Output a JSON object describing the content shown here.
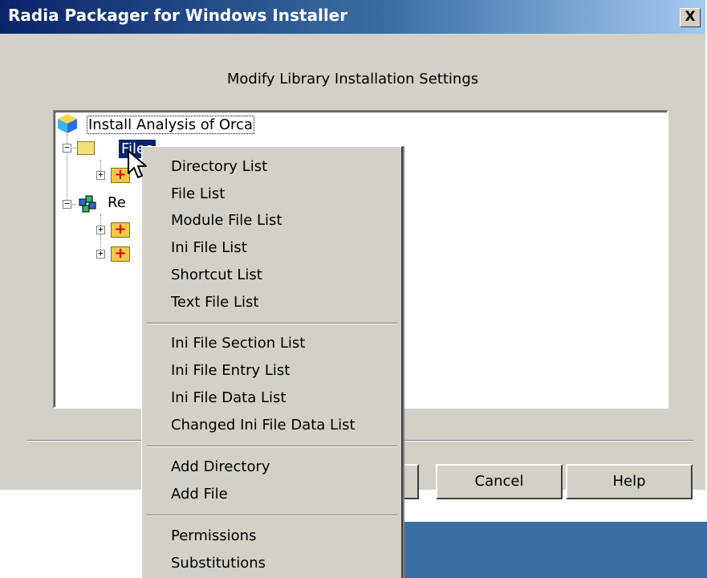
{
  "window": {
    "title": "Radia Packager for Windows Installer",
    "close_label": "X"
  },
  "heading": "Modify Library Installation Settings",
  "tree": {
    "root": "Install Analysis of Orca",
    "node1": "Files",
    "node2": "Re"
  },
  "buttons": {
    "cancel": "Cancel",
    "help": "Help"
  },
  "context_menu": {
    "groups": [
      [
        "Directory List",
        "File List",
        "Module File List",
        "Ini File List",
        "Shortcut List",
        "Text File List"
      ],
      [
        "Ini File Section List",
        "Ini File Entry List",
        "Ini File Data List",
        "Changed Ini File Data List"
      ],
      [
        "Add Directory",
        "Add File"
      ],
      [
        "Permissions",
        "Substitutions"
      ]
    ]
  },
  "colors": {
    "title_gradient_start": "#0a246a",
    "dialog_bg": "#d4d0c8",
    "selection": "#0a246a",
    "taskbar": "#3a6ea5"
  },
  "icons": [
    "close-icon",
    "root-cube-icon",
    "folder-icon",
    "folder-plus-icon",
    "registry-icon",
    "mouse-cursor-icon"
  ]
}
